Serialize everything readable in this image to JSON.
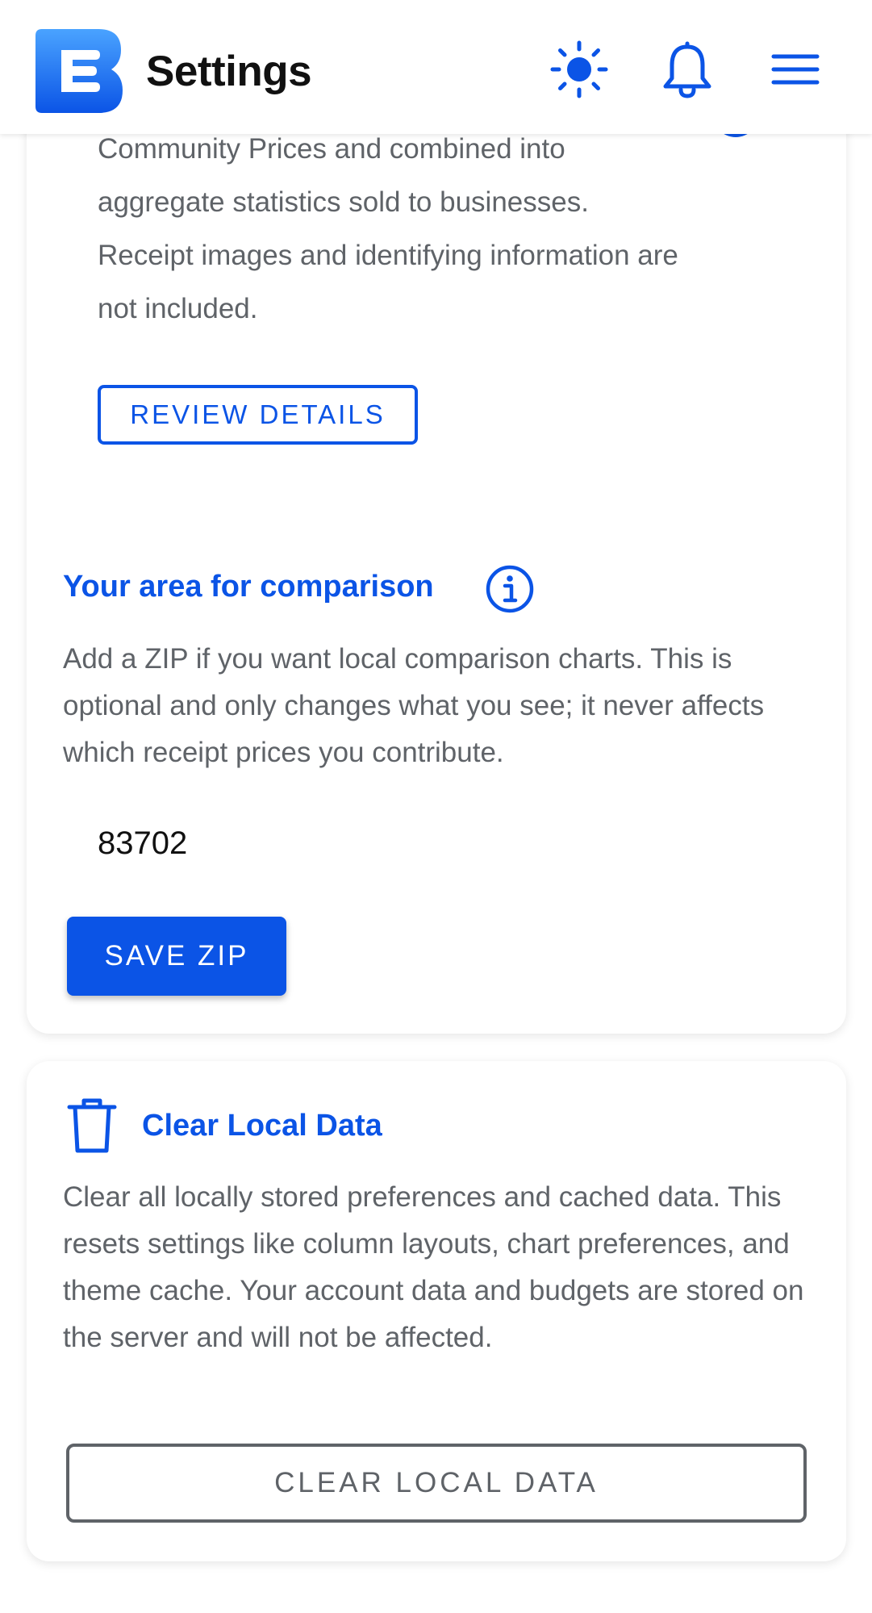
{
  "header": {
    "title": "Settings",
    "logo_icon": "app-logo-icon",
    "theme_icon": "sun-icon",
    "notifications_icon": "bell-icon",
    "menu_icon": "hamburger-menu-icon"
  },
  "data_sharing": {
    "description": "Community Prices and combined into aggregate statistics sold to businesses. Receipt images and identifying information are not included.",
    "review_button_label": "REVIEW DETAILS"
  },
  "comparison_area": {
    "title": "Your area for comparison",
    "info_icon": "info-icon",
    "description": "Add a ZIP if you want local comparison charts. This is optional and only changes what you see; it never affects which receipt prices you contribute.",
    "zip_value": "83702",
    "save_button_label": "SAVE ZIP"
  },
  "clear_local_data": {
    "icon": "trash-icon",
    "title": "Clear Local Data",
    "description": "Clear all locally stored preferences and cached data. This resets settings like column layouts, chart preferences, and theme cache. Your account data and budgets are stored on the server and will not be affected.",
    "button_label": "CLEAR LOCAL DATA"
  },
  "colors": {
    "accent": "#0b54e6",
    "muted_text": "#5f6368",
    "title_text": "#111111"
  }
}
